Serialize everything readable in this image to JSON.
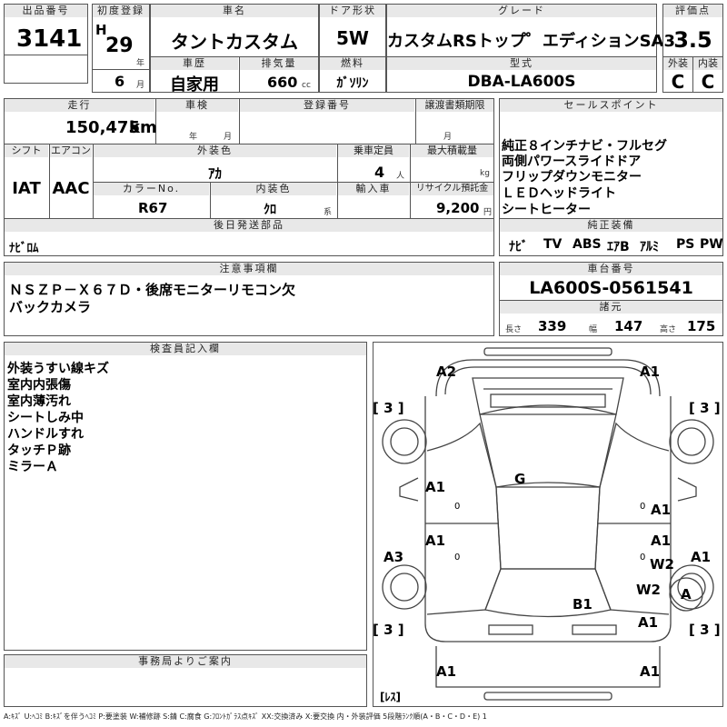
{
  "header": {
    "lot_no_label": "出品番号",
    "lot_no": "3141",
    "first_reg_label": "初度登録",
    "era": "H",
    "year": "29",
    "year_unit": "年",
    "month": "6",
    "month_unit": "月",
    "car_name_label": "車名",
    "car_name": "タントカスタム",
    "history_label": "車歴",
    "history": "自家用",
    "displacement_label": "排気量",
    "displacement": "660",
    "displacement_unit": "cc",
    "door_label": "ドア形状",
    "door": "5W",
    "fuel_label": "燃料",
    "fuel": "ｶﾞｿﾘﾝ",
    "grade_label": "グレード",
    "grade": "カスタムRSトップ゜エディションSA3",
    "model_label": "型式",
    "model": "DBA-LA600S",
    "score_label": "評価点",
    "score": "3.5",
    "exterior_label": "外装",
    "interior_label": "内装",
    "exterior_grade": "C",
    "interior_grade": "C"
  },
  "info": {
    "mileage_label": "走行",
    "mileage": "150,475",
    "mileage_unit": "km",
    "inspection_label": "車検",
    "year_unit": "年",
    "month_unit": "月",
    "reg_no_label": "登録番号",
    "transfer_label": "譲渡書類期限",
    "shift_label": "シフト",
    "shift": "IAT",
    "ac_label": "エアコン",
    "ac": "AAC",
    "ext_color_label": "外装色",
    "ext_color": "ｱｶ",
    "capacity_label": "乗車定員",
    "capacity": "4",
    "capacity_unit": "人",
    "max_load_label": "最大積載量",
    "max_load_unit": "kg",
    "color_no_label": "カラーNo.",
    "color_no": "R67",
    "int_color_label": "内装色",
    "int_color": "ｸﾛ",
    "int_color_unit": "系",
    "import_label": "輸入車",
    "recycle_label": "リサイクル預託金",
    "recycle": "9,200",
    "recycle_unit": "円",
    "parts_label": "後日発送部品",
    "parts": "ﾅﾋﾞﾛﾑ"
  },
  "sales": {
    "label": "セールスポイント",
    "points": [
      "純正８インチナビ・フルセグ",
      "両側パワースライドドア",
      "フリップダウンモニター",
      "ＬＥＤヘッドライト",
      "シートヒーター"
    ],
    "equip_label": "純正装備",
    "equipment": [
      "ﾅﾋﾞ",
      "TV",
      "ABS",
      "ｴｱB",
      "ｱﾙﾐ",
      "PS",
      "PW"
    ]
  },
  "notes": {
    "label": "注意事項欄",
    "lines": [
      "ＮＳＺＰ－Ｘ６７Ｄ・後席モニターリモコン欠",
      "バックカメラ"
    ]
  },
  "chassis": {
    "label": "車台番号",
    "number": "LA600S-0561541",
    "dims_label": "諸元",
    "length_label": "長さ",
    "length": "339",
    "width_label": "幅",
    "width": "147",
    "height_label": "高さ",
    "height": "175"
  },
  "inspector": {
    "label": "検査員記入欄",
    "lines": [
      "外装うすい線キズ",
      "室内内張傷",
      "室内薄汚れ",
      "シートしみ中",
      "ハンドルすれ",
      "タッチＰ跡",
      "ミラーＡ"
    ]
  },
  "diagram": {
    "marks": [
      {
        "id": "front-left-corner",
        "text": "A2"
      },
      {
        "id": "front-right-corner",
        "text": "A1"
      },
      {
        "id": "tire-front-left",
        "text": "[ 3 ]"
      },
      {
        "id": "tire-front-right",
        "text": "[ 3 ]"
      },
      {
        "id": "windshield",
        "text": "G"
      },
      {
        "id": "front-left-door",
        "text": "A1"
      },
      {
        "id": "front-right-door",
        "text": "A1"
      },
      {
        "id": "rear-left-door",
        "text": "A1"
      },
      {
        "id": "rear-right-door",
        "text": "A1"
      },
      {
        "id": "left-rear-quarter",
        "text": "A3"
      },
      {
        "id": "right-rear-quarter",
        "text": "A1"
      },
      {
        "id": "right-side-w2-upper",
        "text": "W2"
      },
      {
        "id": "right-side-w2-lower",
        "text": "W2"
      },
      {
        "id": "spare-wheel",
        "text": "A"
      },
      {
        "id": "roof-rear",
        "text": "B1"
      },
      {
        "id": "rear-right-fender",
        "text": "A1"
      },
      {
        "id": "tire-rear-left",
        "text": "[ 3 ]"
      },
      {
        "id": "tire-rear-right",
        "text": "[ 3 ]"
      },
      {
        "id": "rear-left-bumper",
        "text": "A1"
      },
      {
        "id": "rear-right-bumper",
        "text": "A1"
      },
      {
        "id": "spare-tire-status",
        "text": "[ﾚｽ]"
      }
    ],
    "door_zero_left_front": "0",
    "door_zero_right_front": "0",
    "door_zero_left_rear": "0",
    "door_zero_right_rear": "0"
  },
  "office": {
    "label": "事務局よりご案内"
  },
  "legend": "A:ｷｽﾞ U:ﾍｺﾐ B:ｷｽﾞを伴うﾍｺﾐ P:要塗装 W:補修跡 S:錆 C:腐食 G:ﾌﾛﾝﾄｶﾞﾗｽ点ｷｽﾞ XX:交換済み X:要交換 内・外装評価 5段階ﾗﾝｸ順(A・B・C・D・E) 1"
}
